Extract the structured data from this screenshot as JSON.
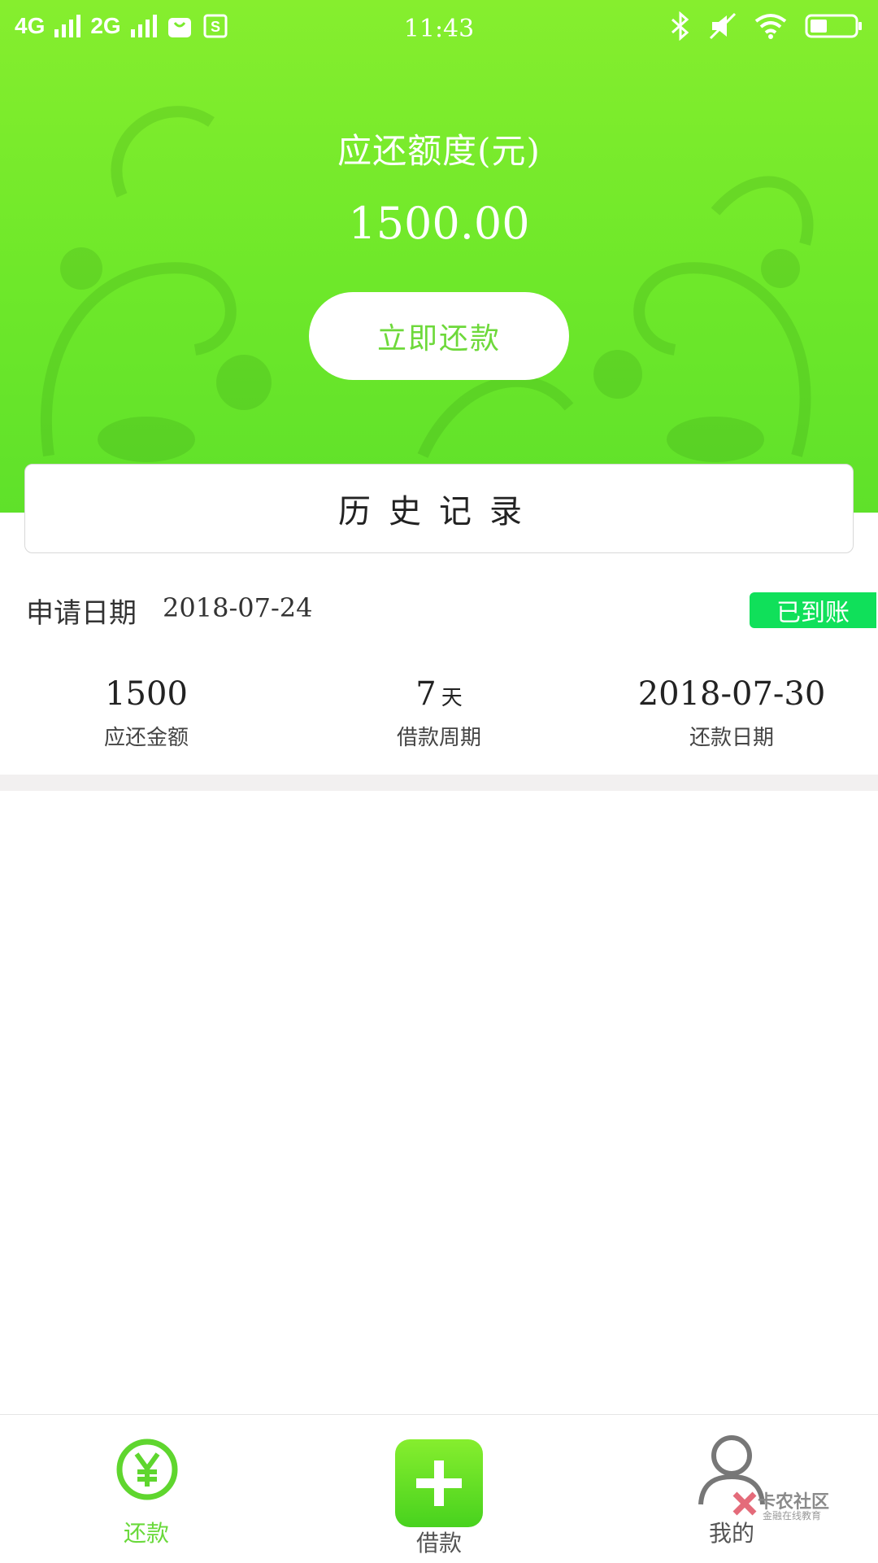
{
  "status_bar": {
    "network_1": "4G",
    "network_2": "2G",
    "time": "11:43"
  },
  "header": {
    "amount_label": "应还额度(元)",
    "amount": "1500.00",
    "repay_button": "立即还款"
  },
  "history": {
    "title": "历史记录"
  },
  "record": {
    "apply_label": "申请日期",
    "apply_date": "2018-07-24",
    "status_badge": "已到账",
    "columns": [
      {
        "value": "1500",
        "unit": "",
        "label": "应还金额"
      },
      {
        "value": "7",
        "unit": "天",
        "label": "借款周期"
      },
      {
        "value": "2018-07-30",
        "unit": "",
        "label": "还款日期"
      }
    ]
  },
  "tabbar": {
    "tabs": [
      {
        "label": "还款",
        "icon": "yuan-icon",
        "color": "#69d93a",
        "active": true
      },
      {
        "label": "借款",
        "icon": "plus-icon",
        "color": "#555555",
        "active": false
      },
      {
        "label": "我的",
        "icon": "user-icon",
        "color": "#555555",
        "active": false
      }
    ]
  },
  "watermark": {
    "title": "卡农社区",
    "subtitle": "金融在线教育"
  },
  "colors": {
    "brand_green": "#6ee82a",
    "badge_green": "#10e05a"
  }
}
